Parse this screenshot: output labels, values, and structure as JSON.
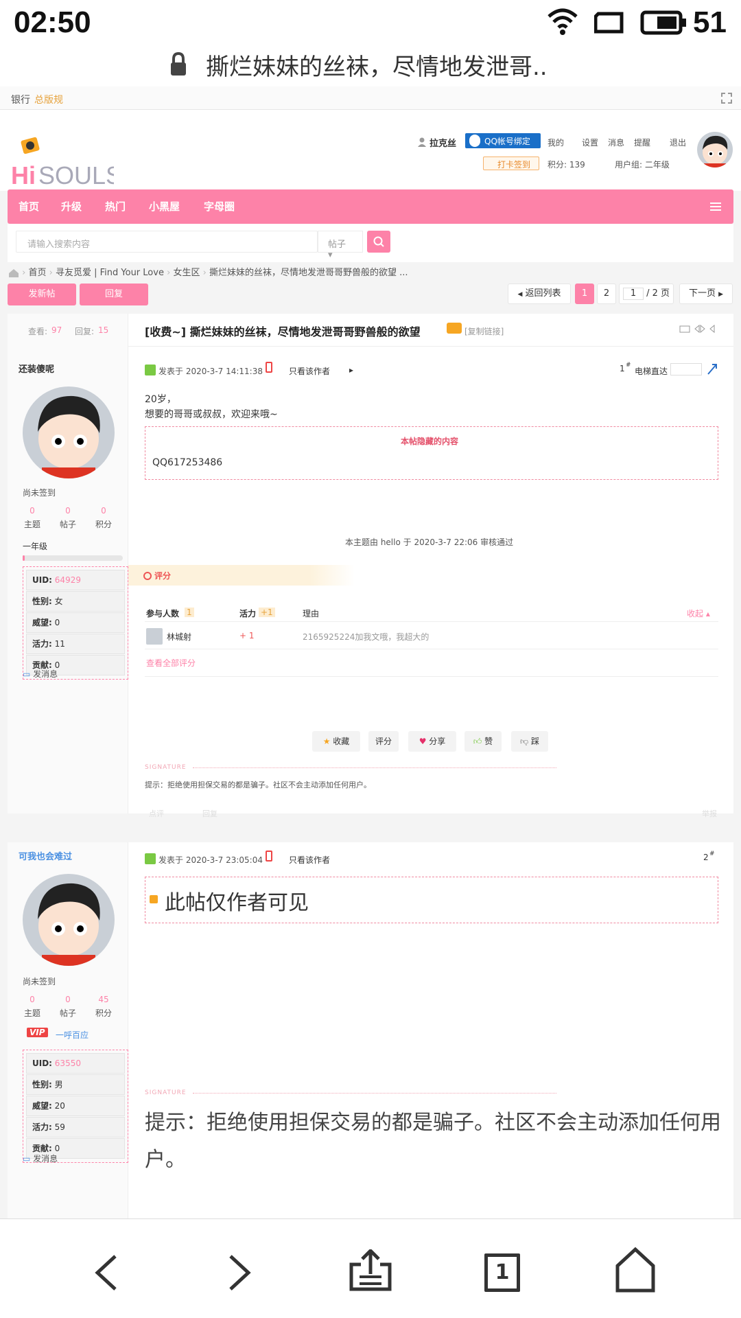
{
  "status_bar": {
    "time": "02:50",
    "battery": "51"
  },
  "browser": {
    "title": "撕烂妹妹的丝袜，尽情地发泄哥.."
  },
  "topline": {
    "item1": "银行",
    "item2": "总版规"
  },
  "user_menu": {
    "username": "拉克丝",
    "qq_bind": "QQ帐号绑定",
    "mine": "我的",
    "settings": "设置",
    "messages": "消息",
    "reminders": "提醒",
    "logout": "退出",
    "checkin": "打卡签到",
    "points": "积分: 139",
    "usergroup": "用户组: 二年级"
  },
  "logo": {
    "text": "HiSOULS"
  },
  "nav": {
    "items": [
      "首页",
      "升级",
      "热门",
      "小黑屋",
      "字母圈"
    ]
  },
  "search": {
    "placeholder": "请输入搜索内容",
    "type": "帖子"
  },
  "breadcrumb": {
    "items": [
      "首页",
      "寻友觅爱 | Find Your Love",
      "女生区",
      "撕烂妹妹的丝袜，尽情地发泄哥哥野兽般的欲望 ..."
    ]
  },
  "actions": {
    "new_post": "发新帖",
    "reply": "回复"
  },
  "pager": {
    "back": "返回列表",
    "page1": "1",
    "page2": "2",
    "input": "1",
    "total": "/ 2 页",
    "next": "下一页"
  },
  "thread": {
    "views_label": "查看:",
    "views": "97",
    "replies_label": "回复:",
    "replies": "15",
    "title": "[收费~] 撕烂妹妹的丝袜，尽情地发泄哥哥野兽般的欲望",
    "copy_link": "[复制链接]"
  },
  "post1": {
    "author": "还装傻呢",
    "signin": "尚未签到",
    "stats": [
      {
        "value": "0",
        "label": "主题"
      },
      {
        "value": "0",
        "label": "帖子"
      },
      {
        "value": "0",
        "label": "积分"
      }
    ],
    "level": "一年级",
    "level_progress": 0.02,
    "profile": [
      {
        "k": "UID:",
        "v": "64929"
      },
      {
        "k": "性别:",
        "v": "女"
      },
      {
        "k": "威望:",
        "v": "0"
      },
      {
        "k": "活力:",
        "v": "11"
      },
      {
        "k": "贡献:",
        "v": "0"
      }
    ],
    "send_msg": "发消息",
    "posted": "发表于 2020-3-7 14:11:38",
    "only_author": "只看该作者",
    "floor": "1",
    "elevator": "电梯直达",
    "content1": "20岁，",
    "content2": "想要的哥哥或叔叔，欢迎来哦~",
    "hidden_title": "本帖隐藏的内容",
    "hidden_content": "QQ617253486",
    "audit": "本主题由 hello 于 2020-3-7 22:06 审核通过",
    "rate_title": "评分",
    "rate_head_people": "参与人数",
    "rate_head_count": "1",
    "rate_head_vitality": "活力",
    "rate_head_plus": "+1",
    "rate_head_reason": "理由",
    "rate_collapse": "收起",
    "rate_user": "林城射",
    "rate_value": "+ 1",
    "rate_reason": "2165925224加我文哦，我超大的",
    "rate_all": "查看全部评分",
    "btn_fav": "收藏",
    "btn_rate": "评分",
    "btn_share": "分享",
    "btn_like": "赞",
    "btn_dislike": "踩",
    "signature_label": "SIGNATURE",
    "signature": "提示：拒绝使用担保交易的都是骗子。社区不会主动添加任何用户。",
    "footer_comment": "点评",
    "footer_reply": "回复",
    "footer_report": "举报"
  },
  "post2": {
    "author": "可我也会难过",
    "signin": "尚未签到",
    "stats": [
      {
        "value": "0",
        "label": "主题"
      },
      {
        "value": "0",
        "label": "帖子"
      },
      {
        "value": "45",
        "label": "积分"
      }
    ],
    "vip": "VIP",
    "vip_text": "一呼百应",
    "profile": [
      {
        "k": "UID:",
        "v": "63550"
      },
      {
        "k": "性别:",
        "v": "男"
      },
      {
        "k": "威望:",
        "v": "20"
      },
      {
        "k": "活力:",
        "v": "59"
      },
      {
        "k": "贡献:",
        "v": "0"
      }
    ],
    "send_msg": "发消息",
    "posted": "发表于 2020-3-7 23:05:04",
    "only_author": "只看该作者",
    "floor": "2",
    "locked": "此帖仅作者可见",
    "signature_label": "SIGNATURE",
    "signature": "提示：拒绝使用担保交易的都是骗子。社区不会主动添加任何用户。"
  },
  "bottom_nav": {
    "tabs": "1"
  }
}
